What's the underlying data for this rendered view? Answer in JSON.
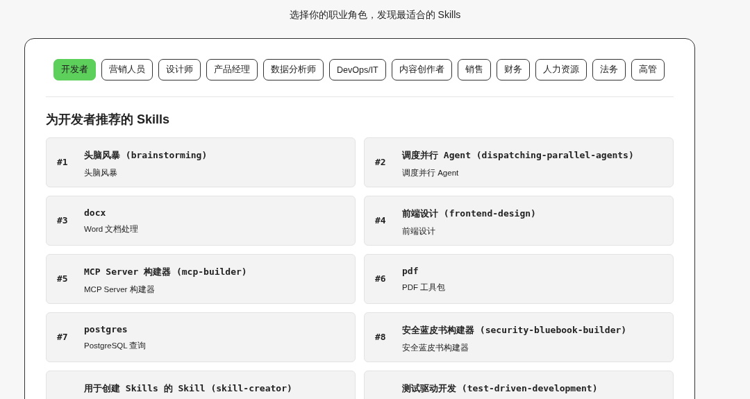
{
  "subtitle": "选择你的职业角色，发现最适合的 Skills",
  "roles": [
    {
      "label": "开发者",
      "selected": true
    },
    {
      "label": "营销人员",
      "selected": false
    },
    {
      "label": "设计师",
      "selected": false
    },
    {
      "label": "产品经理",
      "selected": false
    },
    {
      "label": "数据分析师",
      "selected": false
    },
    {
      "label": "DevOps/IT",
      "selected": false
    },
    {
      "label": "内容创作者",
      "selected": false
    },
    {
      "label": "销售",
      "selected": false
    },
    {
      "label": "财务",
      "selected": false
    },
    {
      "label": "人力资源",
      "selected": false
    },
    {
      "label": "法务",
      "selected": false
    },
    {
      "label": "高管",
      "selected": false
    }
  ],
  "heading": "为开发者推荐的 Skills",
  "skills": [
    {
      "rank": "#1",
      "title": "头脑风暴 (brainstorming)",
      "description": "头脑风暴"
    },
    {
      "rank": "#2",
      "title": "调度并行 Agent (dispatching-parallel-agents)",
      "description": "调度并行 Agent"
    },
    {
      "rank": "#3",
      "title": "docx",
      "description": "Word 文档处理"
    },
    {
      "rank": "#4",
      "title": "前端设计 (frontend-design)",
      "description": "前端设计"
    },
    {
      "rank": "#5",
      "title": "MCP Server 构建器 (mcp-builder)",
      "description": "MCP Server 构建器"
    },
    {
      "rank": "#6",
      "title": "pdf",
      "description": "PDF 工具包"
    },
    {
      "rank": "#7",
      "title": "postgres",
      "description": "PostgreSQL 查询"
    },
    {
      "rank": "#8",
      "title": "安全蓝皮书构建器 (security-bluebook-builder)",
      "description": "安全蓝皮书构建器"
    },
    {
      "title": "用于创建 Skills 的 Skill (skill-creator)"
    },
    {
      "title": "测试驱动开发 (test-driven-development)"
    }
  ]
}
